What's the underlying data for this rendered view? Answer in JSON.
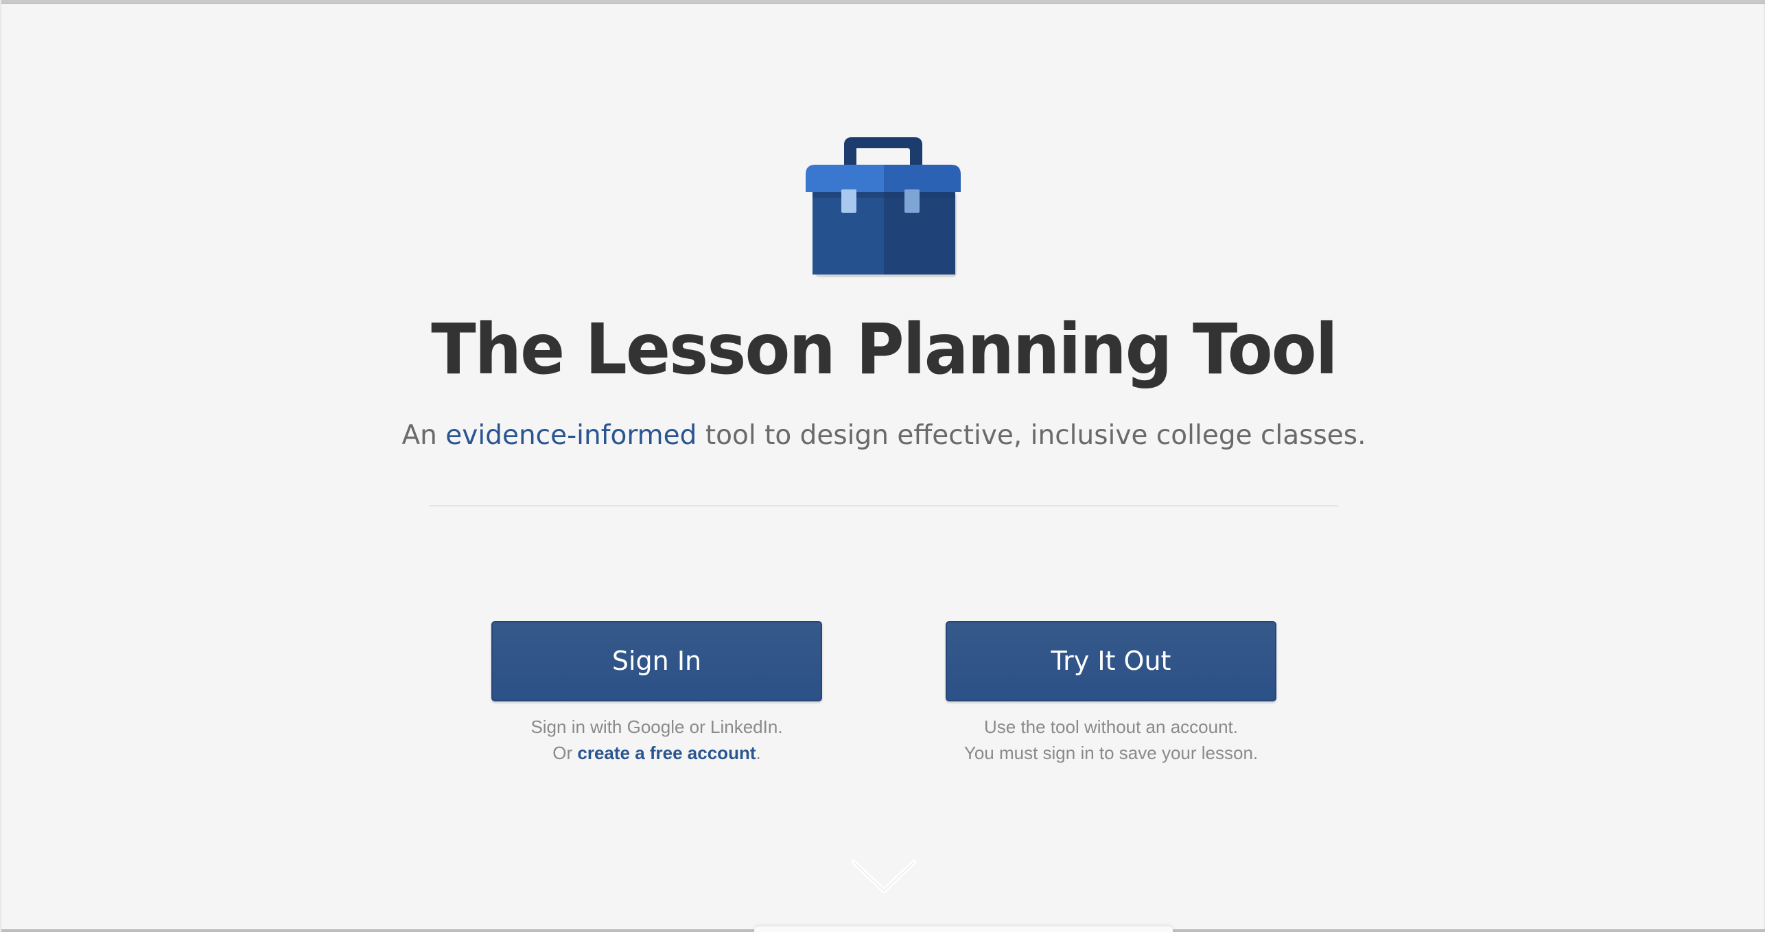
{
  "hero": {
    "title": "The Lesson Planning Tool",
    "tagline_prefix": "An ",
    "tagline_link": "evidence-informed",
    "tagline_suffix": " tool to design effective, inclusive college classes."
  },
  "sign_in": {
    "button_label": "Sign In",
    "note_line1": "Sign in with Google or LinkedIn.",
    "note_line2_prefix": "Or ",
    "note_line2_link": "create a free account",
    "note_line2_suffix": "."
  },
  "try_it": {
    "button_label": "Try It Out",
    "note_line1": "Use the tool without an account.",
    "note_line2": "You must sign in to save your lesson."
  },
  "icons": {
    "logo": "toolbox-icon",
    "scroll": "chevron-down-icon"
  },
  "colors": {
    "background": "#f5f5f5",
    "title": "#333333",
    "tagline": "#6a6a6a",
    "link": "#2a5590",
    "button": "#2f5487",
    "logo_light": "#3a78d0",
    "logo_dark": "#1c3c6e"
  }
}
